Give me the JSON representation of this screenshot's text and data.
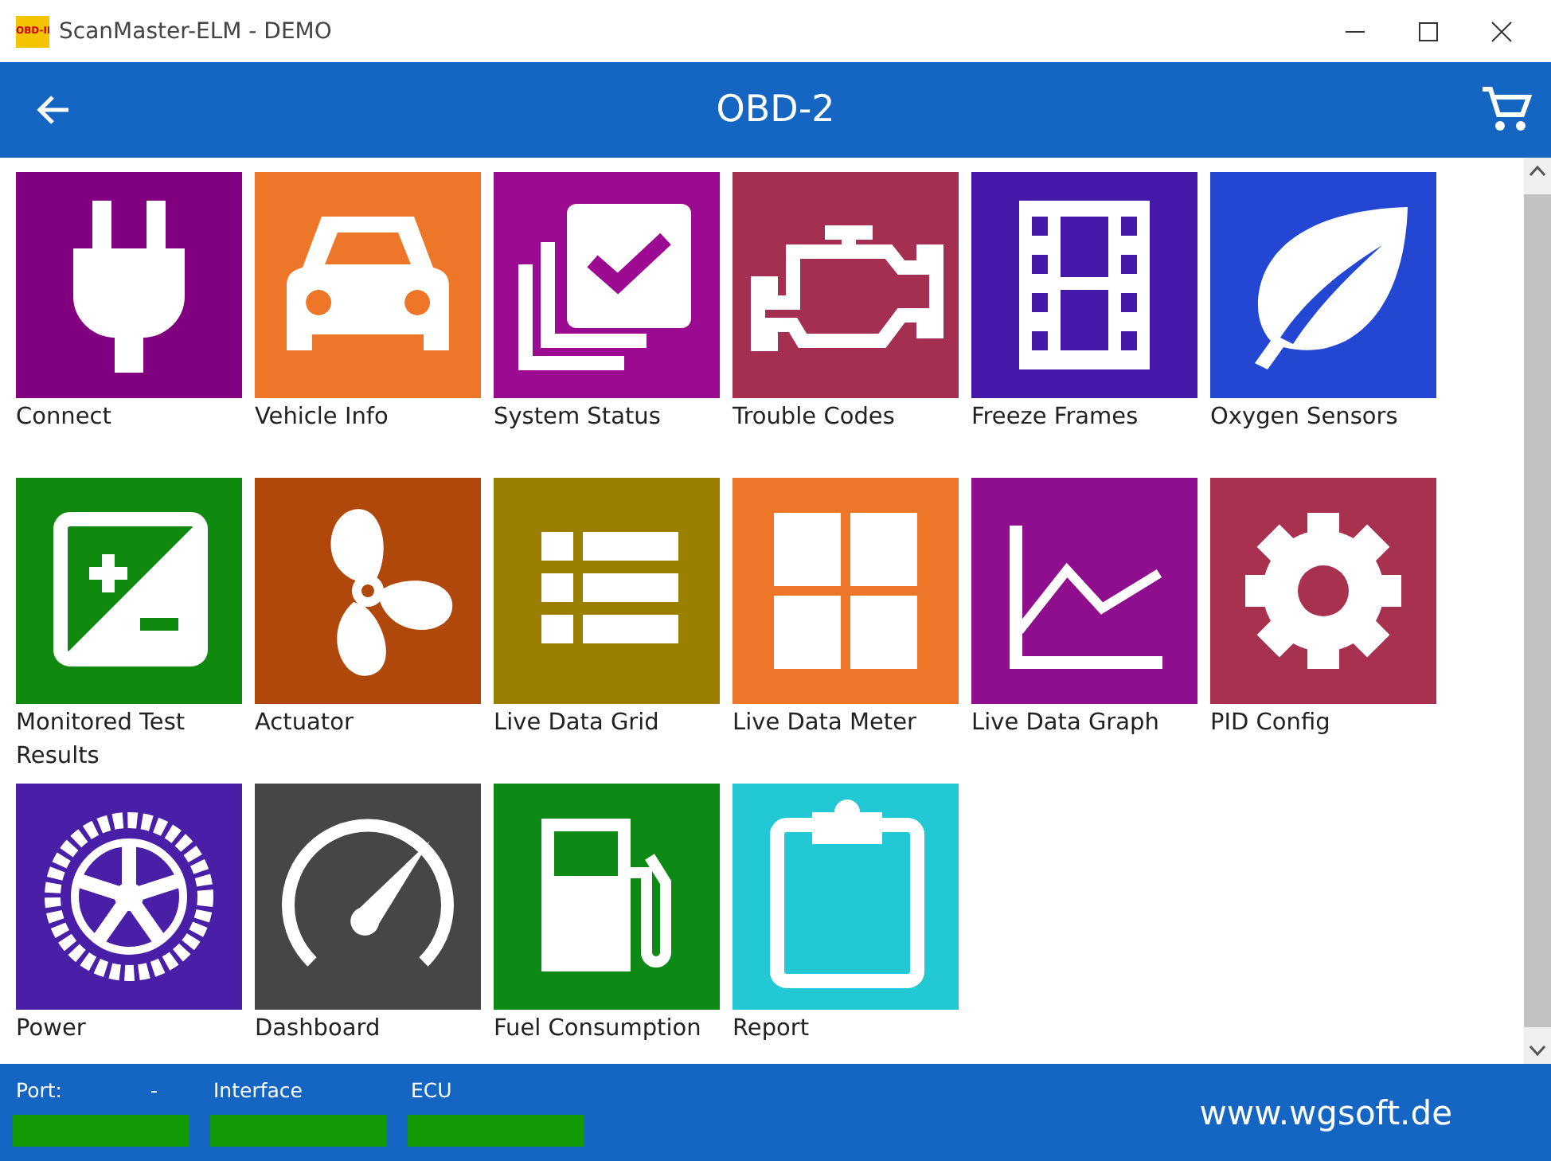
{
  "window": {
    "title": "ScanMaster-ELM - DEMO",
    "app_icon_text": "OBD-II"
  },
  "header": {
    "title": "OBD-2"
  },
  "tiles": [
    {
      "kind": "plug",
      "label": "Connect",
      "color": "#800080"
    },
    {
      "kind": "car",
      "label": "Vehicle Info",
      "color": "#ee7628"
    },
    {
      "kind": "check",
      "label": "System Status",
      "color": "#9b0a90"
    },
    {
      "kind": "engine",
      "label": "Trouble Codes",
      "color": "#a52f50"
    },
    {
      "kind": "film",
      "label": "Freeze Frames",
      "color": "#4418a8"
    },
    {
      "kind": "leaf",
      "label": "Oxygen Sensors",
      "color": "#2347d2"
    },
    {
      "kind": "plusminus",
      "label": "Monitored Test Results",
      "color": "#0f8a0f"
    },
    {
      "kind": "fan",
      "label": "Actuator",
      "color": "#b0480c"
    },
    {
      "kind": "list",
      "label": "Live Data Grid",
      "color": "#9a7f00"
    },
    {
      "kind": "grid",
      "label": "Live Data Meter",
      "color": "#ee7628"
    },
    {
      "kind": "chart",
      "label": "Live Data Graph",
      "color": "#8e0e8e"
    },
    {
      "kind": "gear",
      "label": "PID Config",
      "color": "#a83150"
    },
    {
      "kind": "wheel",
      "label": "Power",
      "color": "#4a1fa8"
    },
    {
      "kind": "gauge",
      "label": "Dashboard",
      "color": "#464646"
    },
    {
      "kind": "fuel",
      "label": "Fuel Consumption",
      "color": "#0d8a16"
    },
    {
      "kind": "clipboard",
      "label": "Report",
      "color": "#22c9d5"
    }
  ],
  "status_bar": {
    "fields": [
      {
        "label": "Port:",
        "value": "-"
      },
      {
        "label": "Interface"
      },
      {
        "label": "ECU"
      }
    ],
    "website": "www.wgsoft.de"
  }
}
